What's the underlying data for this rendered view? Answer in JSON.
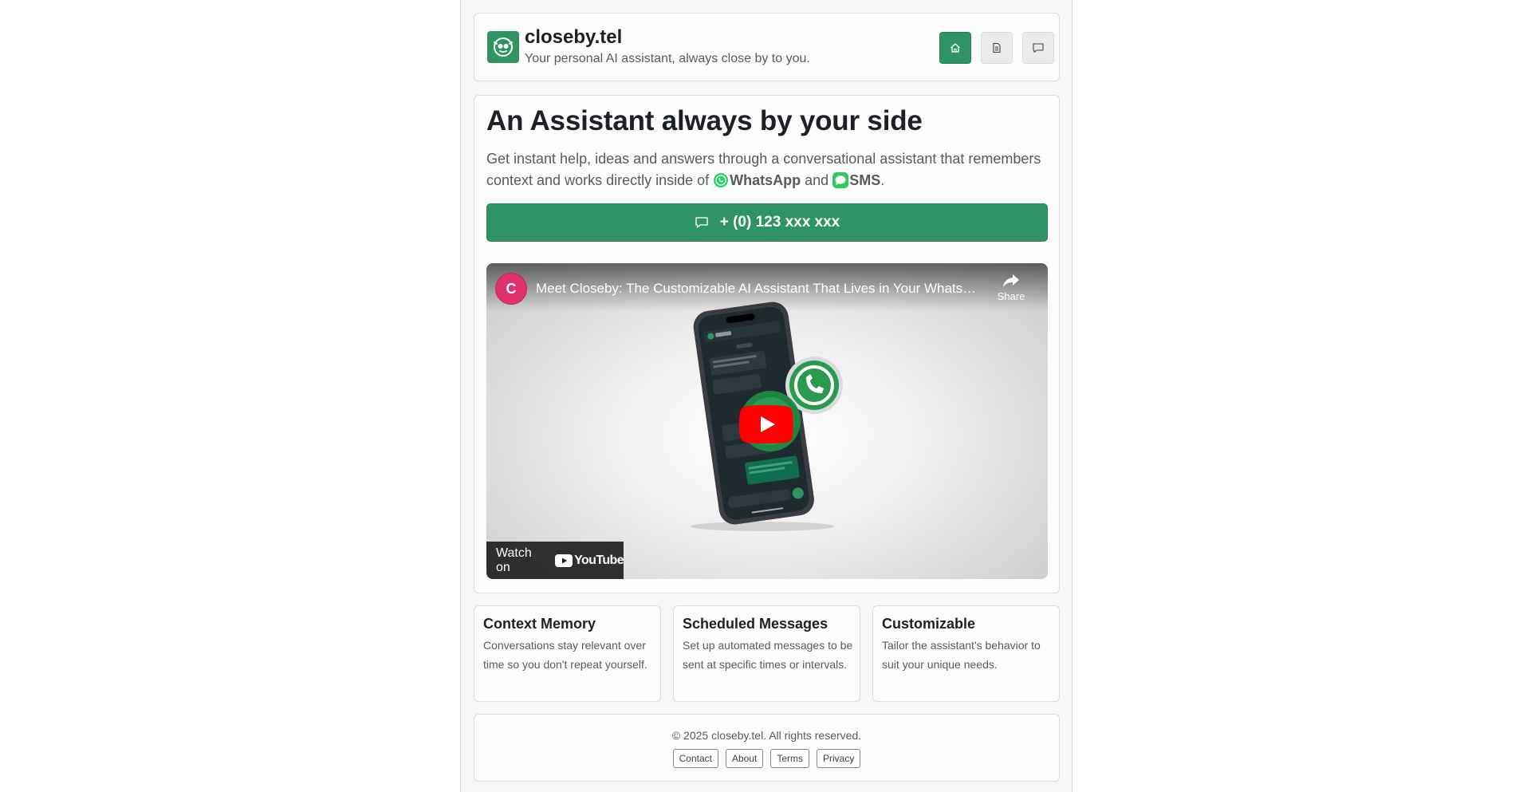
{
  "header": {
    "brand_title": "closeby.tel",
    "brand_subtitle": "Your personal AI assistant, always close by to you.",
    "logo_icon": "robot-face-icon",
    "nav": [
      {
        "icon": "home-icon",
        "active": true
      },
      {
        "icon": "document-icon",
        "active": false
      },
      {
        "icon": "chat-icon",
        "active": false
      }
    ]
  },
  "hero": {
    "title": "An Assistant always by your side",
    "desc_part1": "Get instant help, ideas and answers through a conversational assistant that remembers context and works directly inside of ",
    "whatsapp": "WhatsApp",
    "desc_and": " and ",
    "sms": "SMS",
    "desc_end": ".",
    "cta_label": "+ (0) 123 xxx xxx"
  },
  "video": {
    "channel_initial": "C",
    "title": "Meet Closeby: The Customizable AI Assistant That Lives in Your WhatsApp",
    "share_label": "Share",
    "watch_on": "Watch on",
    "youtube_word": "YouTube"
  },
  "features": [
    {
      "title": "Context Memory",
      "desc": "Conversations stay relevant over time so you don't repeat yourself."
    },
    {
      "title": "Scheduled Messages",
      "desc": "Set up automated messages to be sent at specific times or intervals."
    },
    {
      "title": "Customizable",
      "desc": "Tailor the assistant's behavior to suit your unique needs."
    }
  ],
  "footer": {
    "copyright": "© 2025 closeby.tel. All rights reserved.",
    "links": [
      "Contact",
      "About",
      "Terms",
      "Privacy"
    ]
  },
  "colors": {
    "accent": "#2f9463",
    "whatsapp": "#25d366",
    "youtube_red": "#ff0000"
  }
}
